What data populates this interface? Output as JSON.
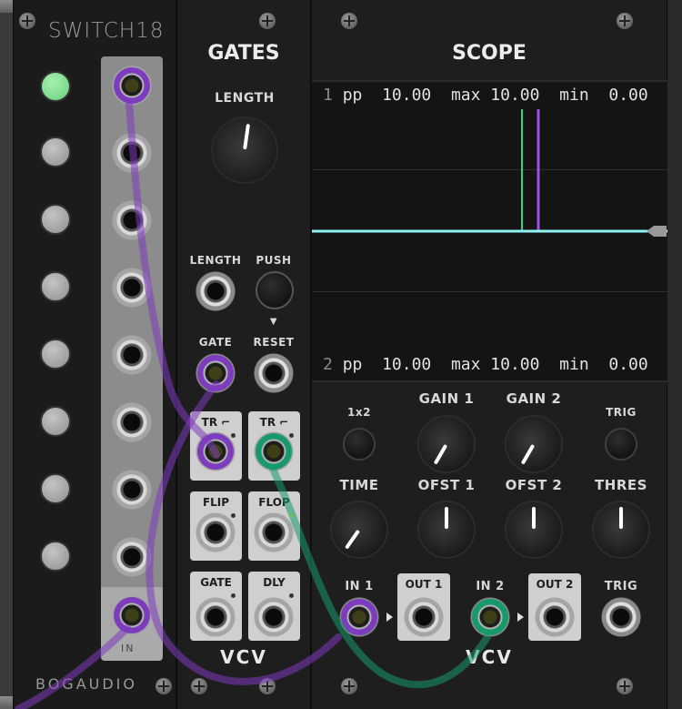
{
  "switch18": {
    "title": "SWITCH18",
    "brand": "BOGAUDIO",
    "in_label": "IN",
    "active_step": 1
  },
  "gates": {
    "title": "GATES",
    "length_knob_label": "LENGTH",
    "length_cv_label": "LENGTH",
    "push_label": "PUSH",
    "gate_label": "GATE",
    "reset_label": "RESET",
    "reset_arrow": "▼",
    "tr_rise_label": "TR ⌐",
    "tr_fall_label": "TR ⌐",
    "flip_label": "FLIP",
    "flop_label": "FLOP",
    "gate_out_label": "GATE",
    "dly_label": "DLY",
    "brand": "VCV"
  },
  "scope": {
    "title": "SCOPE",
    "channel1": {
      "num": "1",
      "pp_label": "pp",
      "pp": "10.00",
      "max_label": "max",
      "max": "10.00",
      "min_label": "min",
      "min": "0.00"
    },
    "channel2": {
      "num": "2",
      "pp_label": "pp",
      "pp": "10.00",
      "max_label": "max",
      "max": "10.00",
      "min_label": "min",
      "min": "0.00"
    },
    "mode_label": "1x2",
    "gain1_label": "GAIN 1",
    "gain2_label": "GAIN 2",
    "trig_button_label": "TRIG",
    "time_label": "TIME",
    "ofst1_label": "OFST 1",
    "ofst2_label": "OFST 2",
    "thres_label": "THRES",
    "in1_label": "IN 1",
    "out1_label": "OUT 1",
    "in2_label": "IN 2",
    "out2_label": "OUT 2",
    "trig_in_label": "TRIG",
    "brand": "VCV",
    "trace_colors": {
      "ch1": "#37d18c",
      "ch2": "#a44ce6",
      "threshold": "#8ff4f4"
    }
  }
}
